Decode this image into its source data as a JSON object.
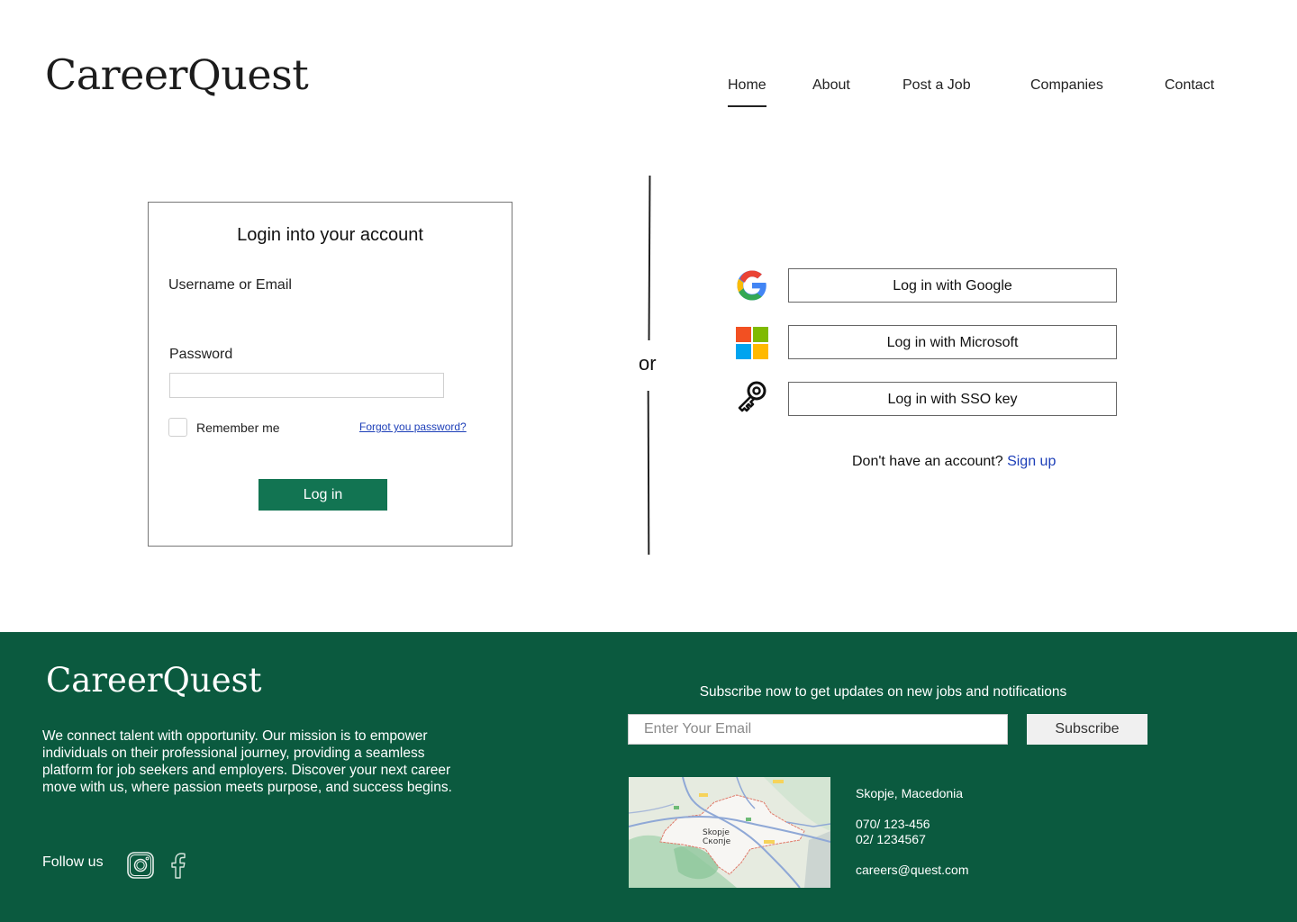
{
  "header": {
    "logo": "CareerQuest",
    "nav": [
      {
        "label": "Home",
        "active": true
      },
      {
        "label": "About",
        "active": false
      },
      {
        "label": "Post a Job",
        "active": false
      },
      {
        "label": "Companies",
        "active": false
      },
      {
        "label": "Contact",
        "active": false
      }
    ]
  },
  "login_form": {
    "title": "Login into your account",
    "username_label": "Username or Email",
    "username_value": "",
    "password_label": "Password",
    "password_value": "",
    "remember_label": "Remember me",
    "remember_checked": false,
    "forgot_link": "Forgot you password?",
    "submit_label": "Log in"
  },
  "divider": {
    "label": "or"
  },
  "sso": {
    "buttons": [
      {
        "label": "Log in with Google",
        "icon": "google-icon"
      },
      {
        "label": "Log in with Microsoft",
        "icon": "microsoft-icon"
      },
      {
        "label": "Log in with SSO key",
        "icon": "key-icon"
      }
    ],
    "signup_prompt": "Don't have an account?",
    "signup_link": "Sign up"
  },
  "footer": {
    "logo": "CareerQuest",
    "description": "We connect talent with opportunity. Our mission is to empower individuals on their professional journey, providing a seamless platform for job seekers and employers. Discover your next career move with us, where passion meets purpose, and success begins.",
    "follow_label": "Follow us",
    "social": [
      "instagram-icon",
      "facebook-icon"
    ],
    "subscribe_heading": "Subscribe now to get updates on new jobs and notifications",
    "email_placeholder": "Enter Your Email",
    "email_value": "",
    "subscribe_label": "Subscribe",
    "map": {
      "city_latin": "Skopje",
      "city_cyrillic": "Скопје"
    },
    "contact": {
      "location": "Skopje, Macedonia",
      "phone_1": "070/ 123-456",
      "phone_2": "02/ 1234567",
      "email": "careers@quest.com"
    }
  },
  "colors": {
    "brand_green": "#0b5a3f",
    "button_green": "#127452",
    "link_blue": "#1d3fb8"
  }
}
